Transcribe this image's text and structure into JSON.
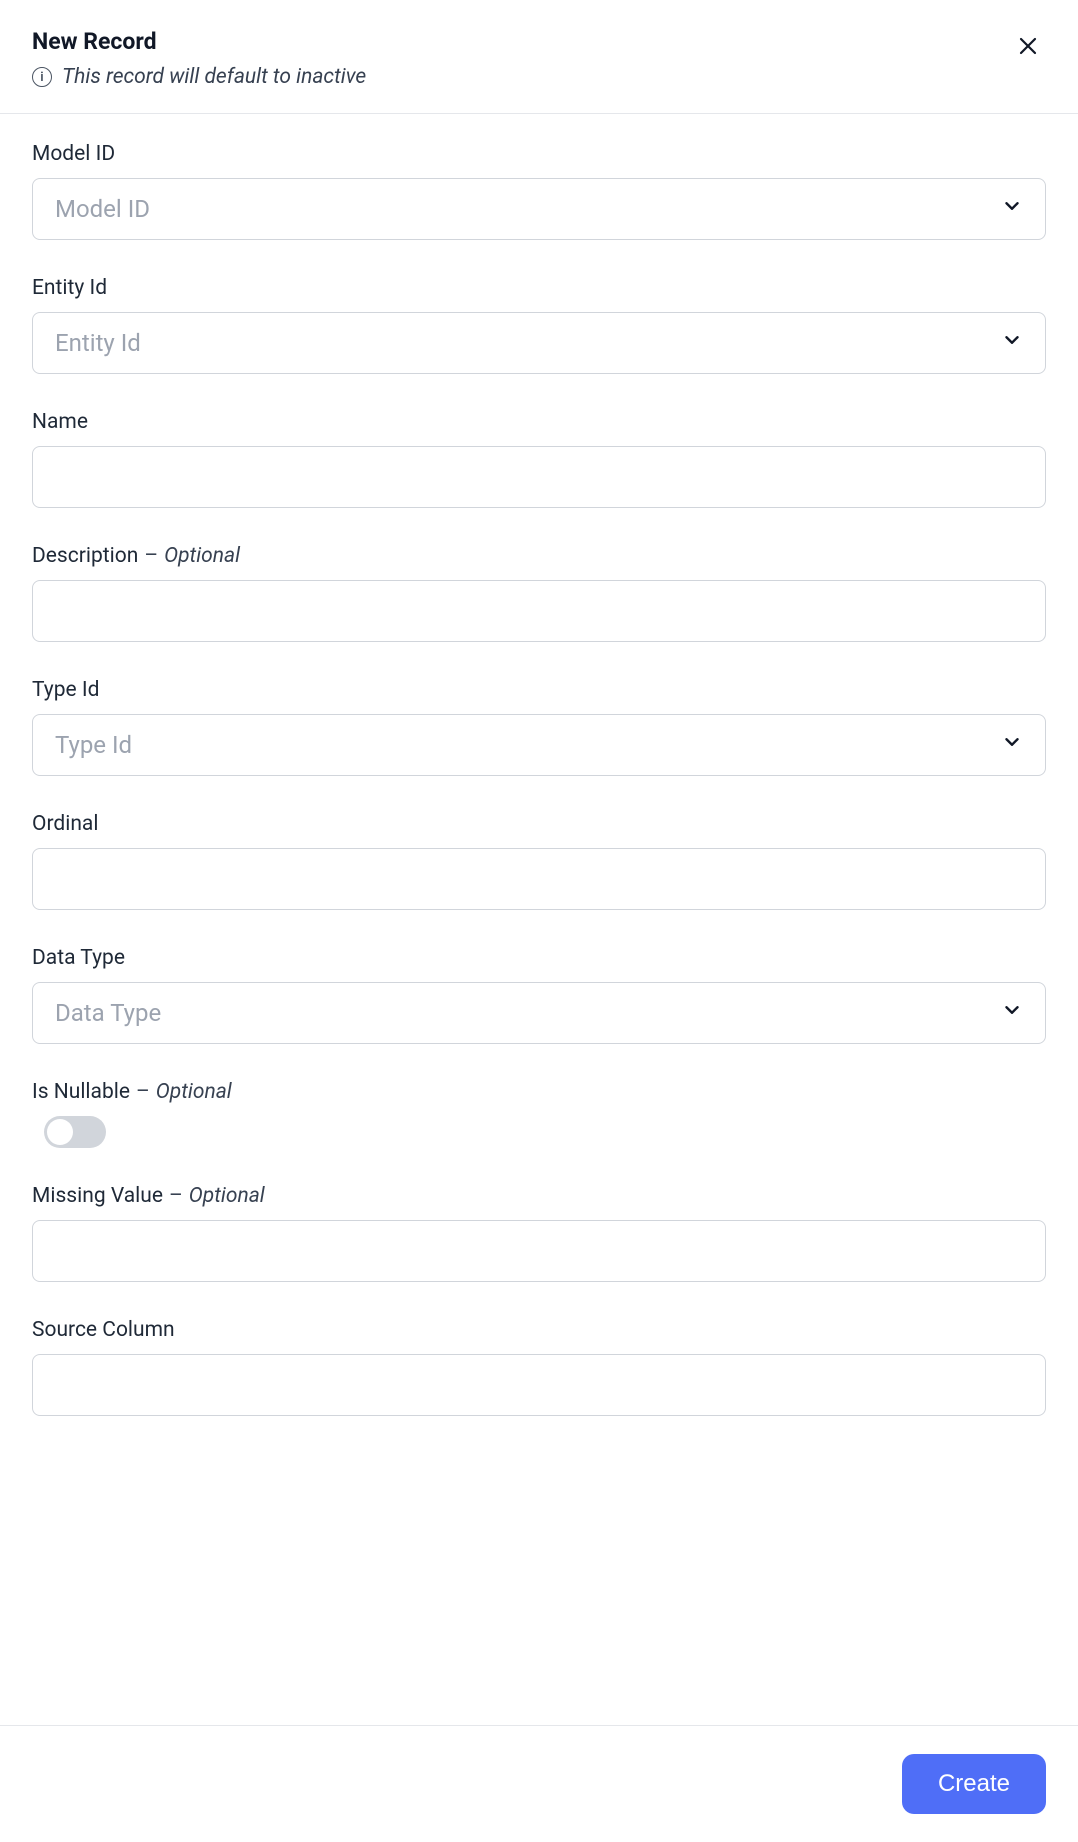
{
  "header": {
    "title": "New Record",
    "subtitle": "This record will default to inactive",
    "info_icon": "i"
  },
  "optional_text": "Optional",
  "fields": {
    "model_id": {
      "label": "Model ID",
      "placeholder": "Model ID",
      "type": "select",
      "value": ""
    },
    "entity_id": {
      "label": "Entity Id",
      "placeholder": "Entity Id",
      "type": "select",
      "value": ""
    },
    "name": {
      "label": "Name",
      "placeholder": "",
      "type": "text",
      "value": ""
    },
    "description": {
      "label": "Description",
      "placeholder": "",
      "type": "text",
      "value": "",
      "optional": true
    },
    "type_id": {
      "label": "Type Id",
      "placeholder": "Type Id",
      "type": "select",
      "value": ""
    },
    "ordinal": {
      "label": "Ordinal",
      "placeholder": "",
      "type": "text",
      "value": ""
    },
    "data_type": {
      "label": "Data Type",
      "placeholder": "Data Type",
      "type": "select",
      "value": ""
    },
    "is_nullable": {
      "label": "Is Nullable",
      "type": "toggle",
      "value": false,
      "optional": true
    },
    "missing_value": {
      "label": "Missing Value",
      "placeholder": "",
      "type": "text",
      "value": "",
      "optional": true
    },
    "source_column": {
      "label": "Source Column",
      "placeholder": "",
      "type": "text",
      "value": ""
    }
  },
  "footer": {
    "create_label": "Create"
  }
}
